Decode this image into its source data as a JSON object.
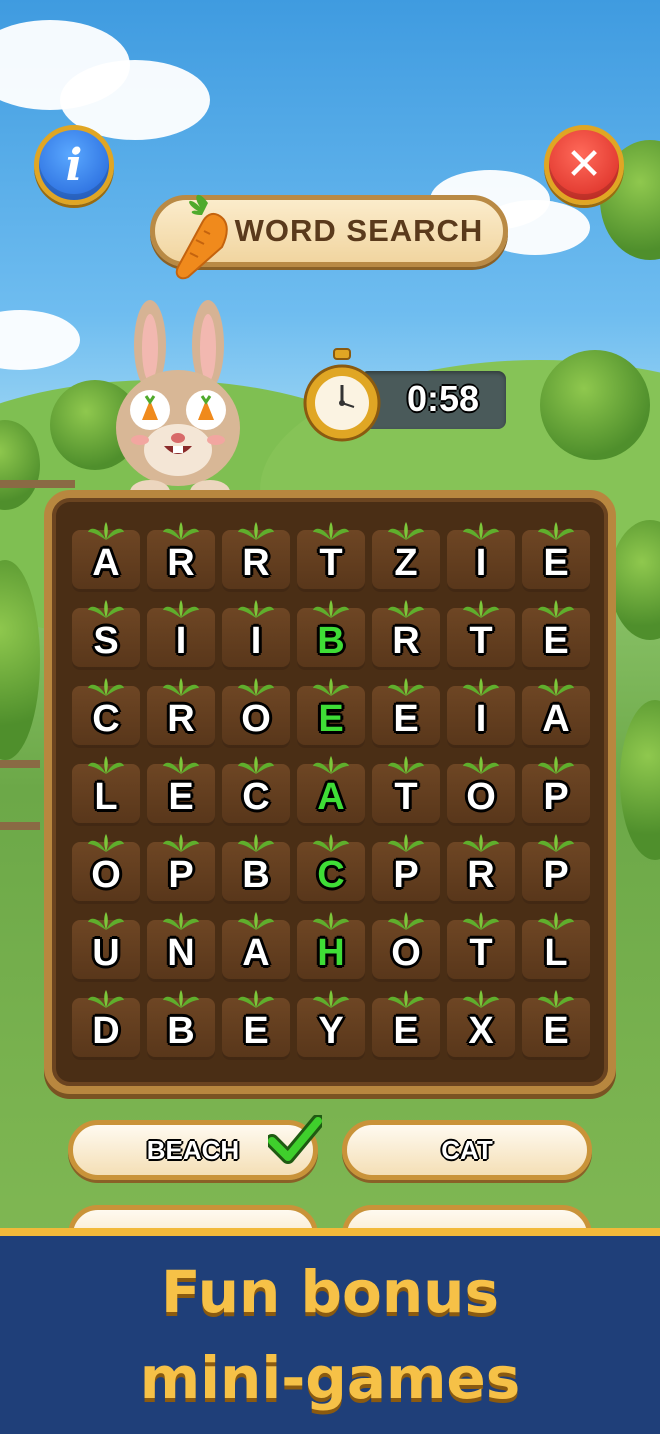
{
  "header": {
    "info_icon": "info-icon",
    "close_icon": "close-icon",
    "info_glyph": "i",
    "close_glyph": "✕",
    "title": "WORD SEARCH"
  },
  "timer": {
    "value": "0:58"
  },
  "grid": {
    "rows": [
      [
        "A",
        "R",
        "R",
        "T",
        "Z",
        "I",
        "E"
      ],
      [
        "S",
        "I",
        "I",
        "B",
        "R",
        "T",
        "E"
      ],
      [
        "C",
        "R",
        "O",
        "E",
        "E",
        "I",
        "A"
      ],
      [
        "L",
        "E",
        "C",
        "A",
        "T",
        "O",
        "P"
      ],
      [
        "O",
        "P",
        "B",
        "C",
        "P",
        "R",
        "P"
      ],
      [
        "U",
        "N",
        "A",
        "H",
        "O",
        "T",
        "L"
      ],
      [
        "D",
        "B",
        "E",
        "Y",
        "E",
        "X",
        "E"
      ]
    ],
    "found_word_cells": "column 4, rows 2-6 (BEACH)",
    "highlight_color": "#3fdd36"
  },
  "words": [
    {
      "label": "BEACH",
      "found": true
    },
    {
      "label": "CAT",
      "found": false
    }
  ],
  "banner": {
    "line1": "Fun bonus",
    "line2": "mini-games"
  },
  "colors": {
    "banner_bg": "#1f3f79",
    "banner_text": "#f6c147",
    "board_frame": "#b8873f"
  }
}
